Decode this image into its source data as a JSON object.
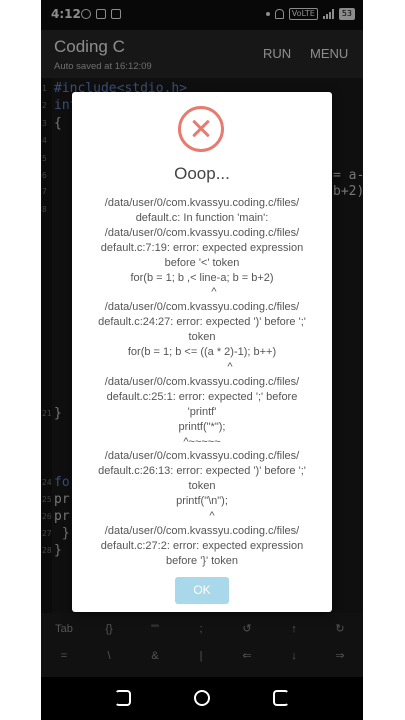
{
  "status_bar": {
    "time": "4:12",
    "volte": "VoLTE",
    "battery": "53"
  },
  "app_bar": {
    "title": "Coding C",
    "subtitle": "Auto saved at 16:12:09",
    "run_label": "RUN",
    "menu_label": "MENU"
  },
  "editor": {
    "lines": [
      {
        "num": "1",
        "text": "#include<stdio.h>"
      },
      {
        "num": "2",
        "text": "int"
      },
      {
        "num": "3",
        "text": "{"
      },
      {
        "num": "4",
        "text": ""
      },
      {
        "num": "5",
        "text": ""
      },
      {
        "num": "6",
        "text": "= a-"
      },
      {
        "num": "7",
        "text": "b+2)"
      },
      {
        "num": "8",
        "text": ""
      },
      {
        "num": "21",
        "text": "}"
      },
      {
        "num": "24",
        "text": "fo"
      },
      {
        "num": "25",
        "text": "pr"
      },
      {
        "num": "26",
        "text": "pr"
      },
      {
        "num": "27",
        "text": " }"
      },
      {
        "num": "28",
        "text": "}"
      }
    ]
  },
  "dialog": {
    "title": "Ooop...",
    "message_lines": [
      "/data/user/0/com.kvassyu.coding.c/files/",
      "default.c: In function 'main':",
      "/data/user/0/com.kvassyu.coding.c/files/",
      "default.c:7:19: error: expected expression",
      "before '<' token",
      "for(b = 1; b ,< line-a; b = b+2)",
      "^",
      "/data/user/0/com.kvassyu.coding.c/files/",
      "default.c:24:27: error: expected ')' before ';'",
      "token",
      "for(b = 1; b <= ((a * 2)-1); b++)",
      "^",
      "/data/user/0/com.kvassyu.coding.c/files/",
      "default.c:25:1: error: expected ';' before",
      "'printf'",
      "printf(\"*\");",
      "^~~~~~",
      "/data/user/0/com.kvassyu.coding.c/files/",
      "default.c:26:13: error: expected ')' before ';'",
      "token",
      "printf(\"\\n\");",
      "^",
      "/data/user/0/com.kvassyu.coding.c/files/",
      "default.c:27:2: error: expected expression",
      "before '}' token"
    ],
    "ok_label": "OK"
  },
  "keys": {
    "row1": [
      "Tab",
      "{}",
      "\"\"",
      ";",
      "↺",
      "↑",
      "↻"
    ],
    "row2": [
      "=",
      "\\",
      "&",
      "|",
      "⇐",
      "↓",
      "⇒"
    ]
  },
  "colors": {
    "dialog_icon": "#e97a6e",
    "ok_button": "#a9d8ea",
    "app_bar": "#2b2b2b"
  }
}
